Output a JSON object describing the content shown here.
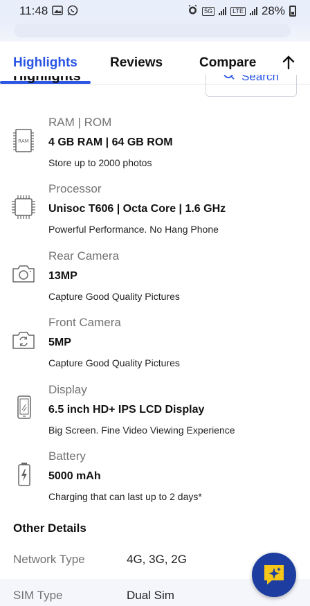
{
  "status_bar": {
    "time": "11:48",
    "network_label_1": "VoLTE 5G",
    "network_label_2": "5G",
    "network_label_3": "VoLTE LTE2",
    "battery": "28%"
  },
  "tabs": [
    {
      "label": "Highlights",
      "active": true
    },
    {
      "label": "Reviews",
      "active": false
    },
    {
      "label": "Compare",
      "active": false
    }
  ],
  "section": {
    "title": "Highlights",
    "search_label": "Search"
  },
  "specs": [
    {
      "icon": "ram-chip-icon",
      "label": "RAM | ROM",
      "value": "4 GB RAM | 64 GB ROM",
      "desc": "Store up to 2000 photos",
      "icon_text": "RAM"
    },
    {
      "icon": "processor-icon",
      "label": "Processor",
      "value": "Unisoc T606 | Octa Core | 1.6 GHz",
      "desc": "Powerful Performance. No Hang Phone"
    },
    {
      "icon": "rear-camera-icon",
      "label": "Rear Camera",
      "value": "13MP",
      "desc": "Capture Good Quality Pictures"
    },
    {
      "icon": "front-camera-icon",
      "label": "Front Camera",
      "value": "5MP",
      "desc": "Capture Good Quality Pictures"
    },
    {
      "icon": "display-icon",
      "label": "Display",
      "value": "6.5 inch HD+ IPS LCD Display",
      "desc": "Big Screen. Fine Video Viewing Experience"
    },
    {
      "icon": "battery-icon",
      "label": "Battery",
      "value": "5000 mAh",
      "desc": "Charging that can last up to 2 days*"
    }
  ],
  "other_details": {
    "title": "Other Details",
    "rows": [
      {
        "key": "Network Type",
        "value": "4G, 3G, 2G"
      },
      {
        "key": "SIM Type",
        "value": "Dual Sim"
      }
    ]
  },
  "colors": {
    "accent": "#2a55e5",
    "muted_text": "#737373",
    "fab_bg": "#1d3ea0",
    "fab_icon": "#f5c518"
  }
}
